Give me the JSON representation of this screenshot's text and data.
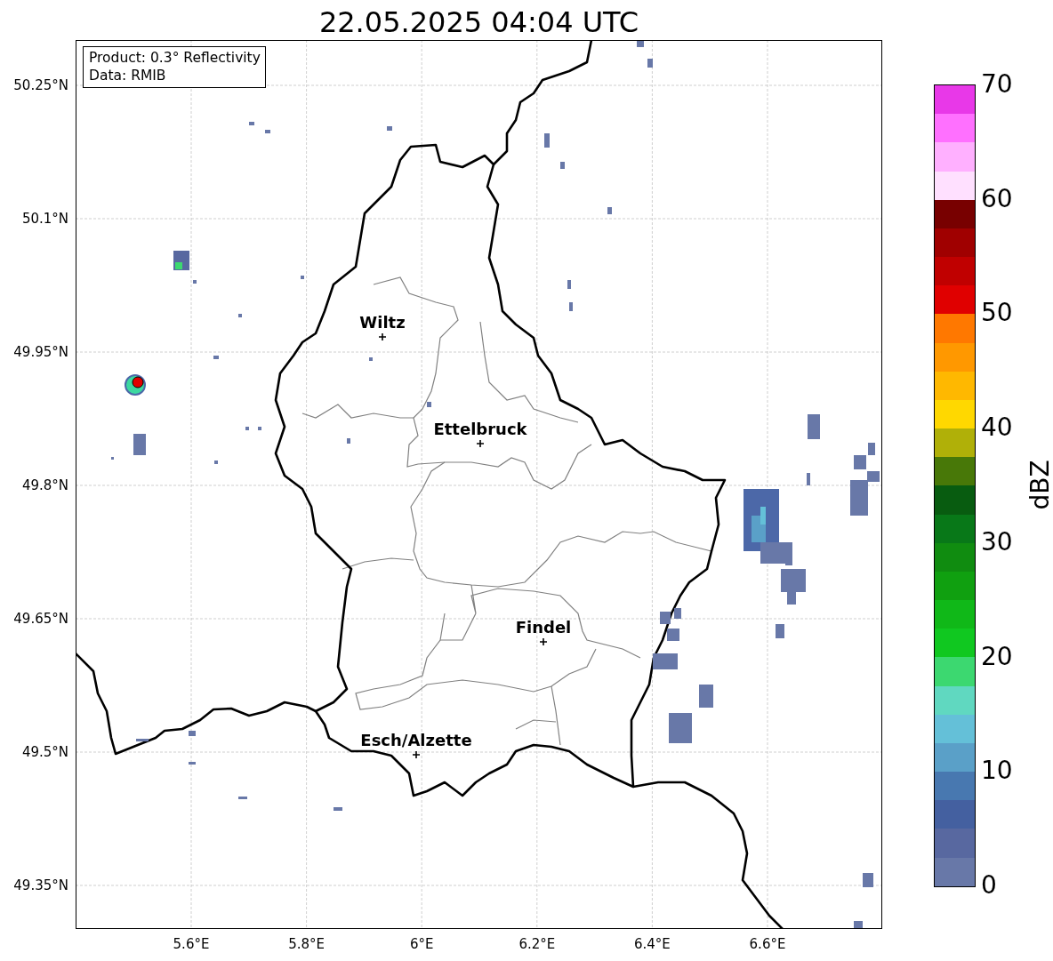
{
  "title": "22.05.2025 04:04 UTC",
  "info_box": {
    "lines": [
      "Product: 0.3° Reflectivity",
      "Data: RMIB"
    ]
  },
  "axes": {
    "yticks": [
      "50.25°N",
      "50.1°N",
      "49.95°N",
      "49.8°N",
      "49.65°N",
      "49.5°N",
      "49.35°N"
    ],
    "xticks": [
      "5.6°E",
      "5.8°E",
      "6°E",
      "6.2°E",
      "6.4°E",
      "6.6°E"
    ]
  },
  "cities": [
    {
      "name": "Wiltz"
    },
    {
      "name": "Ettelbruck"
    },
    {
      "name": "Findel"
    },
    {
      "name": "Esch/Alzette"
    }
  ],
  "colorbar": {
    "label": "dBZ",
    "ticks": [
      "70",
      "60",
      "50",
      "40",
      "30",
      "20",
      "10",
      "0"
    ],
    "bins": [
      {
        "color": "#e838e8"
      },
      {
        "color": "#ff70ff"
      },
      {
        "color": "#ffb0ff"
      },
      {
        "color": "#ffe0ff"
      },
      {
        "color": "#780000"
      },
      {
        "color": "#a00000"
      },
      {
        "color": "#c00000"
      },
      {
        "color": "#e00000"
      },
      {
        "color": "#ff7800"
      },
      {
        "color": "#ff9800"
      },
      {
        "color": "#ffb800"
      },
      {
        "color": "#ffd800"
      },
      {
        "color": "#b0b008"
      },
      {
        "color": "#487808"
      },
      {
        "color": "#085c10"
      },
      {
        "color": "#087818"
      },
      {
        "color": "#108c10"
      },
      {
        "color": "#10a010"
      },
      {
        "color": "#10b818"
      },
      {
        "color": "#10c820"
      },
      {
        "color": "#3cd870"
      },
      {
        "color": "#60d8c0"
      },
      {
        "color": "#64c0d8"
      },
      {
        "color": "#5aa0c8"
      },
      {
        "color": "#4878b0"
      },
      {
        "color": "#4460a0"
      },
      {
        "color": "#5868a0"
      },
      {
        "color": "#6878a8"
      }
    ]
  }
}
